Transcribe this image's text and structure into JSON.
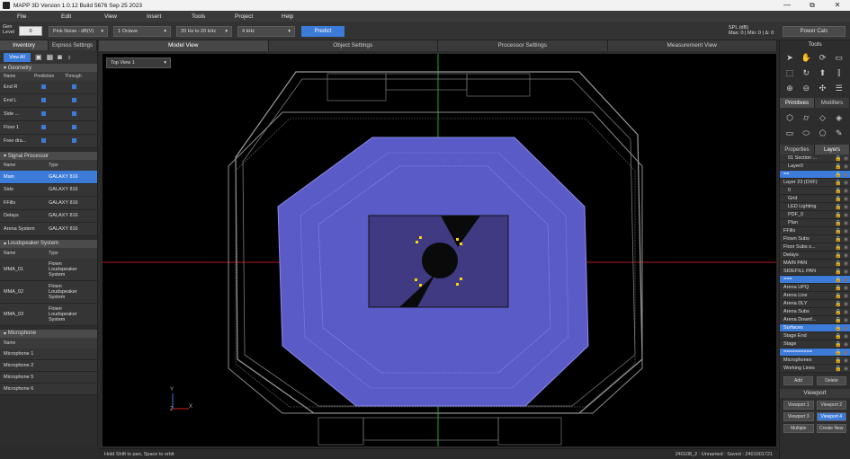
{
  "window": {
    "title": "MAPP 3D Version 1.0.12 Build 5676 Sep 25 2023",
    "min": "—",
    "max": "⧉",
    "close": "✕"
  },
  "menu": [
    "File",
    "Edit",
    "View",
    "Insert",
    "Tools",
    "Project",
    "Help"
  ],
  "toolbar": {
    "gen_label_1": "Gen",
    "gen_label_2": "Level",
    "gen_value": "0",
    "signal": "Pink Noise - dB(V)",
    "octave": "1 Octave",
    "range": "20 Hz to 20 kHz",
    "freq": "4 kHz",
    "predict": "Predict",
    "spl_label": "SPL (dB)",
    "spl_values": "Max: 0 | Min: 0 | Δ: 0",
    "power_calc": "Power Calc"
  },
  "left": {
    "tabs": [
      "Inventory",
      "Express Settings"
    ],
    "view_all": "View All",
    "geometry": {
      "title": "Geometry",
      "headers": [
        "Name",
        "Prediction",
        "Through"
      ],
      "rows": [
        "End R",
        "End L",
        "Side ...",
        "Floor 1",
        "Free dra..."
      ]
    },
    "signal_processor": {
      "title": "Signal Processor",
      "headers": [
        "Name",
        "Type"
      ],
      "rows": [
        {
          "name": "Main",
          "type": "GALAXY 816"
        },
        {
          "name": "Side",
          "type": "GALAXY 816"
        },
        {
          "name": "FFills",
          "type": "GALAXY 816"
        },
        {
          "name": "Delays",
          "type": "GALAXY 816"
        },
        {
          "name": "Arena System",
          "type": "GALAXY 816"
        }
      ]
    },
    "loudspeaker": {
      "title": "Loudspeaker System",
      "headers": [
        "Name",
        "Type"
      ],
      "rows": [
        {
          "name": "MMA_01",
          "type": "Flown Loudspeaker System"
        },
        {
          "name": "MMA_02",
          "type": "Flown Loudspeaker System"
        },
        {
          "name": "MMA_03",
          "type": "Flown Loudspeaker System"
        }
      ]
    },
    "microphone": {
      "title": "Microphone",
      "headers": [
        "Name"
      ],
      "rows": [
        "Microphone 1",
        "Microphone 2",
        "Microphone 5",
        "Microphone 6"
      ]
    }
  },
  "view_tabs": [
    "Model View",
    "Object Settings",
    "Processor Settings",
    "Measurement View"
  ],
  "viewport": {
    "view_select": "Top View 1",
    "axis_x": "X",
    "axis_y": "Y",
    "axis_z": "Z"
  },
  "right": {
    "tools_title": "Tools",
    "prim_tabs": [
      "Primitives",
      "Modifiers"
    ],
    "prop_tabs": [
      "Properties",
      "Layers"
    ],
    "layers": [
      {
        "name": "01 Section ...",
        "indent": 1
      },
      {
        "name": "Layer0",
        "indent": 1
      },
      {
        "name": "==",
        "indent": 0,
        "sel": true
      },
      {
        "name": "Layer 23 (DXF)",
        "indent": 0
      },
      {
        "name": "0",
        "indent": 1
      },
      {
        "name": "Grid",
        "indent": 1
      },
      {
        "name": "LED Lighting",
        "indent": 1
      },
      {
        "name": "PDF_0",
        "indent": 1
      },
      {
        "name": "Plan",
        "indent": 1
      },
      {
        "name": "FFills",
        "indent": 0
      },
      {
        "name": "Flown Subs",
        "indent": 0
      },
      {
        "name": "Floor Subs x...",
        "indent": 0
      },
      {
        "name": "Delays",
        "indent": 0
      },
      {
        "name": "MAIN PAN",
        "indent": 0
      },
      {
        "name": "SIDEFILL PAN",
        "indent": 0
      },
      {
        "name": "===",
        "indent": 0,
        "sel": true
      },
      {
        "name": "Arena UPQ",
        "indent": 0
      },
      {
        "name": "Arena Line",
        "indent": 0
      },
      {
        "name": "Arena DLY",
        "indent": 0
      },
      {
        "name": "Arena Subs",
        "indent": 0
      },
      {
        "name": "Arena Downf...",
        "indent": 0
      },
      {
        "name": "Surfaces",
        "indent": 0,
        "sel": true
      },
      {
        "name": "Stage End",
        "indent": 0
      },
      {
        "name": "Stage",
        "indent": 0
      },
      {
        "name": "==========",
        "indent": 0,
        "sel": true
      },
      {
        "name": "Microphones",
        "indent": 0
      },
      {
        "name": "Working Lines",
        "indent": 0
      }
    ],
    "add": "Add",
    "delete": "Delete",
    "viewport_title": "Viewport",
    "viewports": [
      "Viewport 1",
      "Viewport 2",
      "Viewport 3",
      "Viewport 4"
    ],
    "multiple": "Multiple",
    "create_new": "Create New"
  },
  "status": {
    "hint": "Hold Shift to pan, Space to orbit",
    "file": "240108_2 : Unnamed : Saved : 2401001721"
  },
  "colors": {
    "accent": "#3d7bd8",
    "seating": "#5b5bc8",
    "stage": "#403a82",
    "speaker": "#ffd800",
    "red_axis": "#d02020",
    "green_axis": "#20b040"
  }
}
